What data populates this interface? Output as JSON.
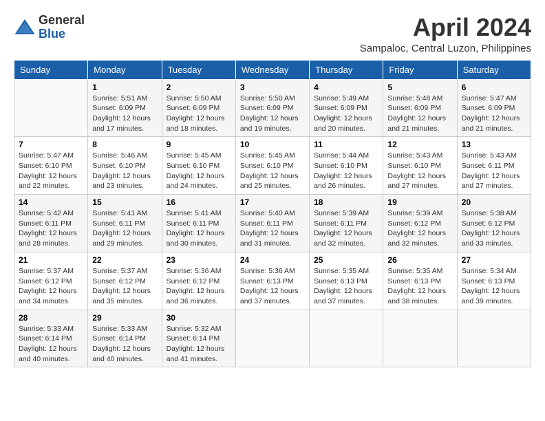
{
  "logo": {
    "general": "General",
    "blue": "Blue"
  },
  "title": {
    "month": "April 2024",
    "location": "Sampaloc, Central Luzon, Philippines"
  },
  "headers": [
    "Sunday",
    "Monday",
    "Tuesday",
    "Wednesday",
    "Thursday",
    "Friday",
    "Saturday"
  ],
  "weeks": [
    [
      {
        "day": "",
        "info": ""
      },
      {
        "day": "1",
        "info": "Sunrise: 5:51 AM\nSunset: 6:09 PM\nDaylight: 12 hours\nand 17 minutes."
      },
      {
        "day": "2",
        "info": "Sunrise: 5:50 AM\nSunset: 6:09 PM\nDaylight: 12 hours\nand 18 minutes."
      },
      {
        "day": "3",
        "info": "Sunrise: 5:50 AM\nSunset: 6:09 PM\nDaylight: 12 hours\nand 19 minutes."
      },
      {
        "day": "4",
        "info": "Sunrise: 5:49 AM\nSunset: 6:09 PM\nDaylight: 12 hours\nand 20 minutes."
      },
      {
        "day": "5",
        "info": "Sunrise: 5:48 AM\nSunset: 6:09 PM\nDaylight: 12 hours\nand 21 minutes."
      },
      {
        "day": "6",
        "info": "Sunrise: 5:47 AM\nSunset: 6:09 PM\nDaylight: 12 hours\nand 21 minutes."
      }
    ],
    [
      {
        "day": "7",
        "info": "Sunrise: 5:47 AM\nSunset: 6:10 PM\nDaylight: 12 hours\nand 22 minutes."
      },
      {
        "day": "8",
        "info": "Sunrise: 5:46 AM\nSunset: 6:10 PM\nDaylight: 12 hours\nand 23 minutes."
      },
      {
        "day": "9",
        "info": "Sunrise: 5:45 AM\nSunset: 6:10 PM\nDaylight: 12 hours\nand 24 minutes."
      },
      {
        "day": "10",
        "info": "Sunrise: 5:45 AM\nSunset: 6:10 PM\nDaylight: 12 hours\nand 25 minutes."
      },
      {
        "day": "11",
        "info": "Sunrise: 5:44 AM\nSunset: 6:10 PM\nDaylight: 12 hours\nand 26 minutes."
      },
      {
        "day": "12",
        "info": "Sunrise: 5:43 AM\nSunset: 6:10 PM\nDaylight: 12 hours\nand 27 minutes."
      },
      {
        "day": "13",
        "info": "Sunrise: 5:43 AM\nSunset: 6:11 PM\nDaylight: 12 hours\nand 27 minutes."
      }
    ],
    [
      {
        "day": "14",
        "info": "Sunrise: 5:42 AM\nSunset: 6:11 PM\nDaylight: 12 hours\nand 28 minutes."
      },
      {
        "day": "15",
        "info": "Sunrise: 5:41 AM\nSunset: 6:11 PM\nDaylight: 12 hours\nand 29 minutes."
      },
      {
        "day": "16",
        "info": "Sunrise: 5:41 AM\nSunset: 6:11 PM\nDaylight: 12 hours\nand 30 minutes."
      },
      {
        "day": "17",
        "info": "Sunrise: 5:40 AM\nSunset: 6:11 PM\nDaylight: 12 hours\nand 31 minutes."
      },
      {
        "day": "18",
        "info": "Sunrise: 5:39 AM\nSunset: 6:11 PM\nDaylight: 12 hours\nand 32 minutes."
      },
      {
        "day": "19",
        "info": "Sunrise: 5:39 AM\nSunset: 6:12 PM\nDaylight: 12 hours\nand 32 minutes."
      },
      {
        "day": "20",
        "info": "Sunrise: 5:38 AM\nSunset: 6:12 PM\nDaylight: 12 hours\nand 33 minutes."
      }
    ],
    [
      {
        "day": "21",
        "info": "Sunrise: 5:37 AM\nSunset: 6:12 PM\nDaylight: 12 hours\nand 34 minutes."
      },
      {
        "day": "22",
        "info": "Sunrise: 5:37 AM\nSunset: 6:12 PM\nDaylight: 12 hours\nand 35 minutes."
      },
      {
        "day": "23",
        "info": "Sunrise: 5:36 AM\nSunset: 6:12 PM\nDaylight: 12 hours\nand 36 minutes."
      },
      {
        "day": "24",
        "info": "Sunrise: 5:36 AM\nSunset: 6:13 PM\nDaylight: 12 hours\nand 37 minutes."
      },
      {
        "day": "25",
        "info": "Sunrise: 5:35 AM\nSunset: 6:13 PM\nDaylight: 12 hours\nand 37 minutes."
      },
      {
        "day": "26",
        "info": "Sunrise: 5:35 AM\nSunset: 6:13 PM\nDaylight: 12 hours\nand 38 minutes."
      },
      {
        "day": "27",
        "info": "Sunrise: 5:34 AM\nSunset: 6:13 PM\nDaylight: 12 hours\nand 39 minutes."
      }
    ],
    [
      {
        "day": "28",
        "info": "Sunrise: 5:33 AM\nSunset: 6:14 PM\nDaylight: 12 hours\nand 40 minutes."
      },
      {
        "day": "29",
        "info": "Sunrise: 5:33 AM\nSunset: 6:14 PM\nDaylight: 12 hours\nand 40 minutes."
      },
      {
        "day": "30",
        "info": "Sunrise: 5:32 AM\nSunset: 6:14 PM\nDaylight: 12 hours\nand 41 minutes."
      },
      {
        "day": "",
        "info": ""
      },
      {
        "day": "",
        "info": ""
      },
      {
        "day": "",
        "info": ""
      },
      {
        "day": "",
        "info": ""
      }
    ]
  ]
}
